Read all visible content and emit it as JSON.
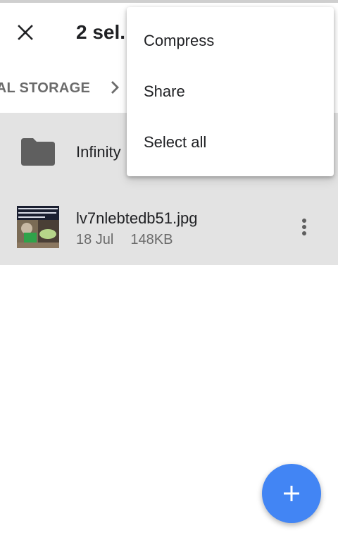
{
  "toolbar": {
    "close_icon": "close-icon",
    "title": "2 sel."
  },
  "breadcrumb": {
    "label": "NAL STORAGE",
    "chevron_icon": "chevron-right-icon"
  },
  "items": [
    {
      "type": "folder",
      "icon": "folder-icon",
      "name": "Infinity",
      "selected": true
    },
    {
      "type": "file",
      "icon": "image-thumbnail",
      "name": "lv7nlebtedb51.jpg",
      "date": "18 Jul",
      "size": "148KB",
      "selected": true,
      "more_icon": "more-vert-icon"
    }
  ],
  "overflow_menu": {
    "items": [
      {
        "label": "Compress"
      },
      {
        "label": "Share"
      },
      {
        "label": "Select all"
      }
    ]
  },
  "fab": {
    "icon": "plus-icon"
  },
  "colors": {
    "selected_row": "#e3e3e3",
    "fab": "#4285f4",
    "folder_icon": "#5f5f5f",
    "text_primary": "#202124",
    "text_secondary": "#6b6b6b"
  }
}
